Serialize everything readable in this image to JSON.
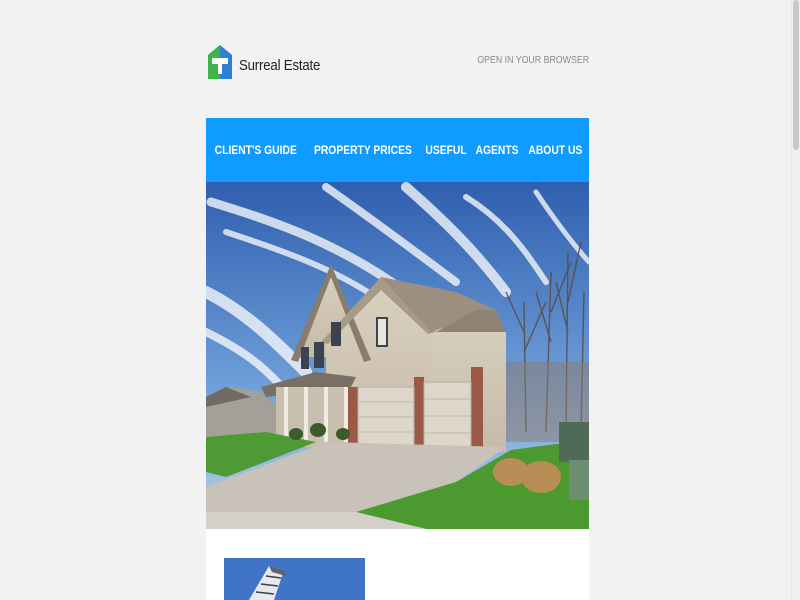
{
  "header": {
    "brand": "Surreal Estate",
    "logo_icon": "house-key-logo-icon",
    "open_in_browser": "OPEN IN YOUR BROWSER"
  },
  "nav": {
    "items": [
      {
        "label": "CLIENT'S GUIDE"
      },
      {
        "label": "PROPERTY PRICES"
      },
      {
        "label": "USEFUL"
      },
      {
        "label": "AGENTS"
      },
      {
        "label": "ABOUT US"
      }
    ]
  },
  "colors": {
    "accent": "#0f9bff",
    "background": "#f2f2f2",
    "logo_green": "#3fb449",
    "logo_blue": "#2f7fd6"
  }
}
